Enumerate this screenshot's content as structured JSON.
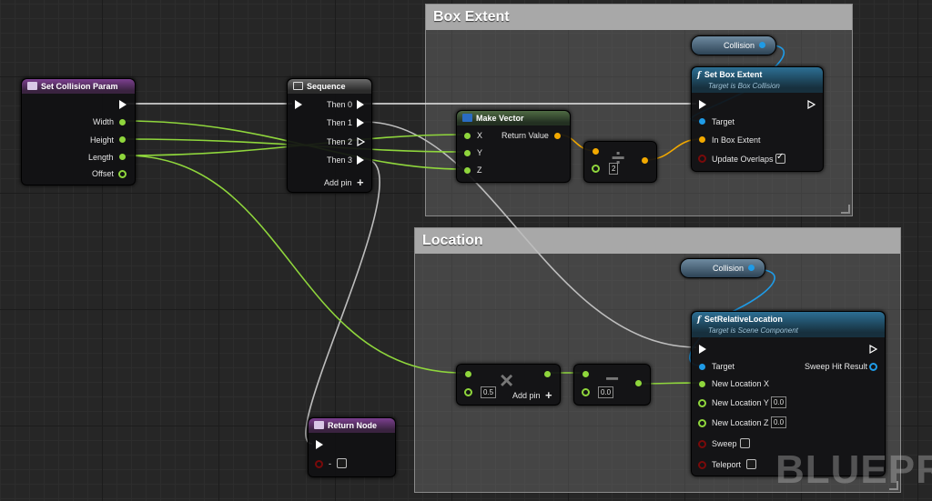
{
  "comments": {
    "box_extent": "Box Extent",
    "location": "Location"
  },
  "nodes": {
    "set_collision_param": {
      "title": "Set Collision Param",
      "pins": [
        "Width",
        "Height",
        "Length",
        "Offset"
      ]
    },
    "sequence": {
      "title": "Sequence",
      "pins": [
        "Then 0",
        "Then 1",
        "Then 2",
        "Then 3"
      ],
      "add_pin": "Add pin"
    },
    "make_vector": {
      "title": "Make Vector",
      "pins": [
        "X",
        "Y",
        "Z"
      ],
      "output": "Return Value"
    },
    "divide_extent": {
      "value": "2"
    },
    "set_box_extent": {
      "title": "Set Box Extent",
      "subtitle": "Target is Box Collision",
      "pins": [
        "Target",
        "In Box Extent",
        "Update Overlaps"
      ]
    },
    "collision_var_1": {
      "label": "Collision"
    },
    "collision_var_2": {
      "label": "Collision"
    },
    "multiply_location": {
      "value": "0.5",
      "add_pin": "Add pin"
    },
    "subtract_location": {
      "value": "0.0"
    },
    "set_relative_location": {
      "title": "SetRelativeLocation",
      "subtitle": "Target is Scene Component",
      "pins": [
        "Target",
        "New Location X",
        "New Location Y",
        "New Location Z",
        "Sweep",
        "Teleport"
      ],
      "output": "Sweep Hit Result",
      "y_value": "0.0",
      "z_value": "0.0"
    },
    "return_node": {
      "title": "Return Node",
      "output_label": "-"
    }
  },
  "watermark": "BLUEPRINT",
  "colors": {
    "exec": "#ffffff",
    "float_pin": "#8fd63c",
    "vector_pin": "#f2a900",
    "object_pin": "#1f9be6",
    "bool_pin": "#7a0a0a",
    "function_header": "#2c6f94",
    "event_header": "#7c3f8f"
  }
}
